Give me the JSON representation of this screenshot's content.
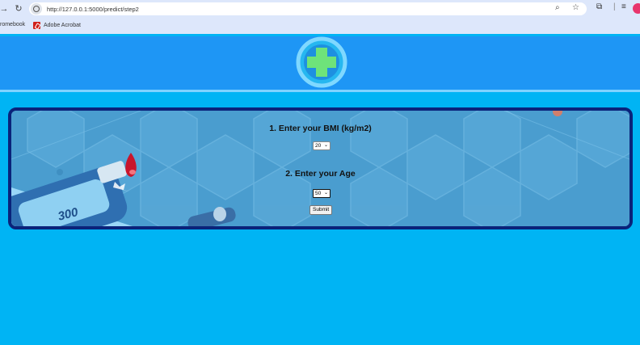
{
  "browser": {
    "url": "http://127.0.0.1:5000/predict/step2",
    "bookmarks": [
      {
        "label": "romebook"
      },
      {
        "label": "Adobe Acrobat"
      }
    ]
  },
  "form": {
    "bmi_label": "1. Enter your BMI (kg/m2)",
    "bmi_value": "20",
    "age_label": "2. Enter your Age",
    "age_value": "50",
    "submit_label": "Submit"
  },
  "illustration": {
    "meter_reading": "300"
  },
  "colors": {
    "page_bg": "#00b4f4",
    "header": "#1e96f5",
    "panel_border": "#0a237a",
    "logo_cross": "#6ee37a"
  }
}
